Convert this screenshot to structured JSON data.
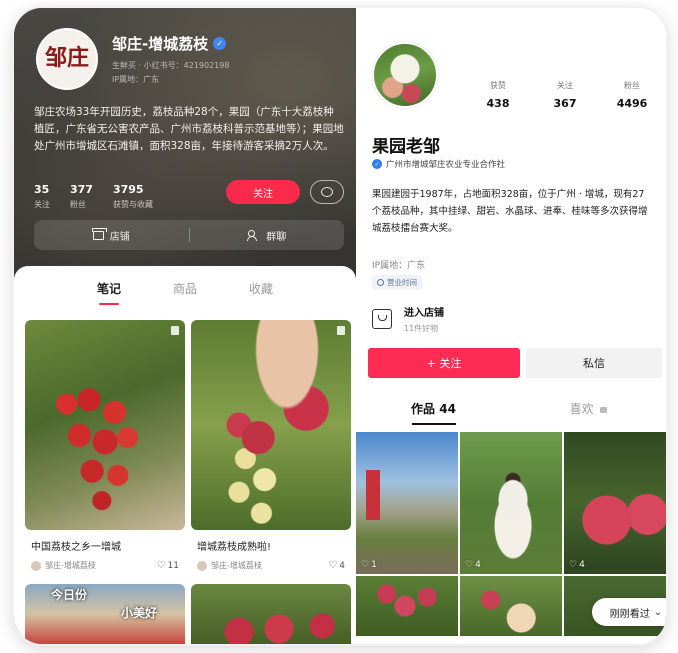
{
  "left": {
    "avatar_text": "邹庄",
    "name": "邹庄-增城荔枝",
    "id_line": "生鲜买 · 小红书号：421902198",
    "ip_line": "IP属地：广东",
    "bio": "邹庄农场33年开园历史，荔枝品种28个，果园（广东十大荔枝种植匠，广东省无公害农产品、广州市荔枝科普示范基地等）；果园地处广州市增城区石滩镇，面积328亩，年接待游客采摘2万人次。",
    "stats": [
      {
        "num": "35",
        "label": "关注"
      },
      {
        "num": "377",
        "label": "粉丝"
      },
      {
        "num": "3795",
        "label": "获赞与收藏"
      }
    ],
    "follow_label": "关注",
    "shop_label": "店铺",
    "group_label": "群聊",
    "tabs": [
      "笔记",
      "商品",
      "收藏"
    ],
    "cards": [
      {
        "title": "中国荔枝之乡一增城",
        "author": "邹庄-增城荔枝",
        "likes": "11"
      },
      {
        "title": "增城荔枝成熟啦!",
        "author": "邹庄-增城荔枝",
        "likes": "4"
      }
    ],
    "strip_text_1": "今日份",
    "strip_text_2": "小美好"
  },
  "right": {
    "stats": [
      {
        "label": "获赞",
        "num": "438"
      },
      {
        "label": "关注",
        "num": "367"
      },
      {
        "label": "粉丝",
        "num": "4496"
      }
    ],
    "name": "果园老邹",
    "org": "广州市增城邹庄农业专业合作社",
    "bio": "果园建园于1987年，占地面积328亩，位于广州 · 增城，现有27个荔枝品种，其中挂绿、甜岩、水晶球、进奉、桂味等多次获得增城荔枝擂台赛大奖。",
    "ip": "IP属地：广东",
    "business_hours": "营业时间",
    "shop_title": "进入店铺",
    "shop_sub": "11件好物",
    "follow_label": "+ 关注",
    "message_label": "私信",
    "tab_works": "作品 44",
    "tab_likes": "喜欢",
    "grid_likes": [
      "1",
      "4",
      "4"
    ],
    "recent_label": "刚刚看过"
  },
  "colors": {
    "xhs_red": "#fa2a4a",
    "douyin_red": "#fe2c55",
    "verified_blue": "#3d86f4"
  }
}
